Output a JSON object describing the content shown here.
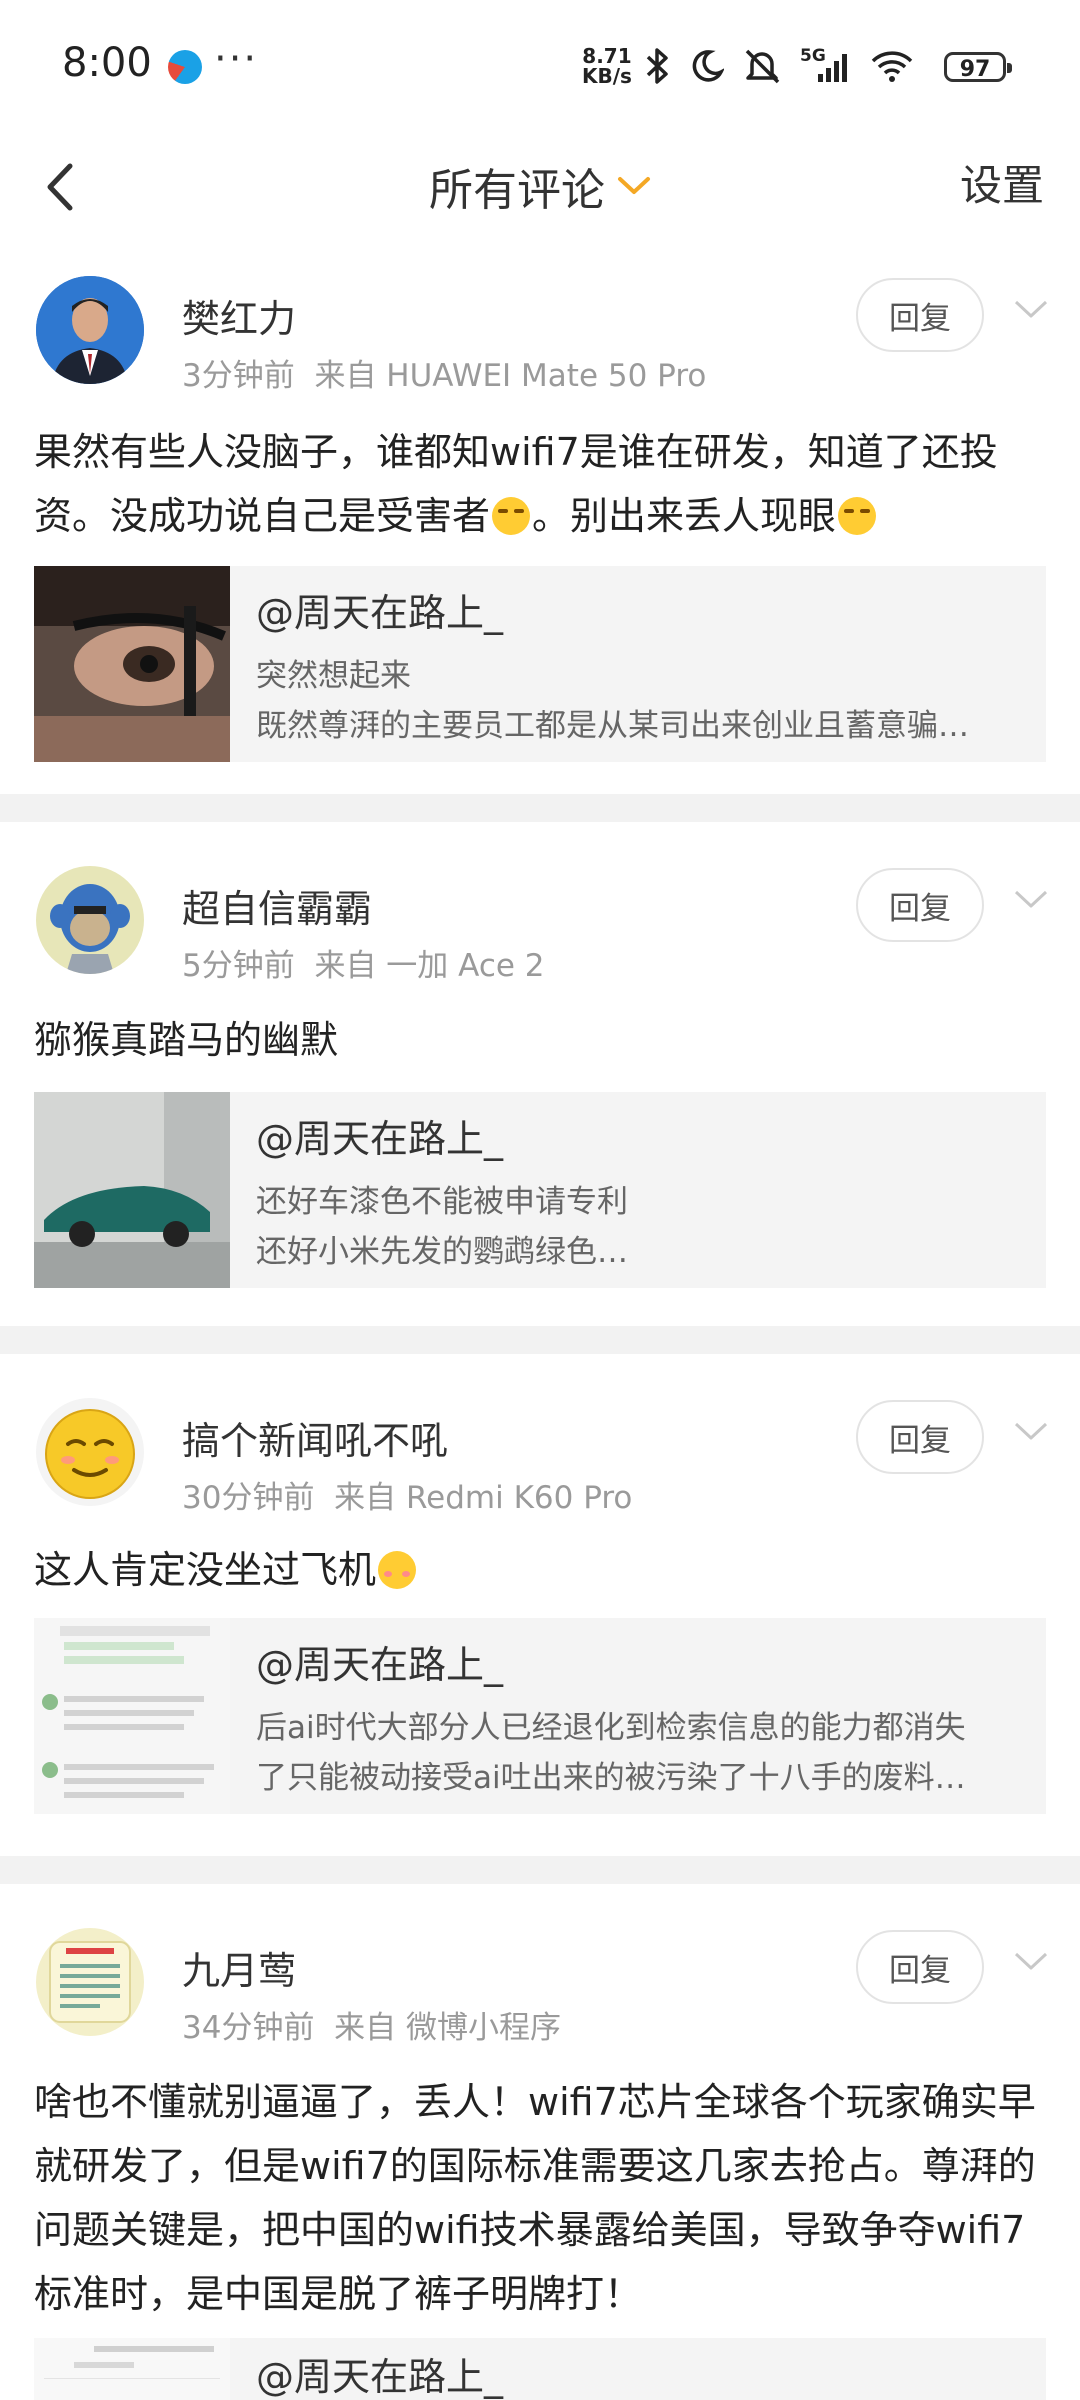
{
  "status_bar": {
    "time": "8:00",
    "dots": "···",
    "speed_value": "8.71",
    "speed_unit": "KB/s",
    "network": "5G",
    "battery": "97"
  },
  "header": {
    "title": "所有评论",
    "settings": "设置"
  },
  "comments": [
    {
      "name": "樊红力",
      "time": "3分钟前",
      "source": "来自 HUAWEI Mate 50 Pro",
      "text_parts": [
        "果然有些人没脑子，谁都知wifi7是谁在研发，知道了还投资。没成功说自己是受害者",
        "。别出来丢人现眼"
      ],
      "reply_label": "回复",
      "quote": {
        "author": "@周天在路上_",
        "line1": "突然想起来",
        "line2": "既然尊湃的主要员工都是从某司出来创业且蓄意骗…"
      }
    },
    {
      "name": "超自信霸霸",
      "time": "5分钟前",
      "source": "来自 一加 Ace 2",
      "text": "猕猴真踏马的幽默",
      "reply_label": "回复",
      "quote": {
        "author": "@周天在路上_",
        "line1": "还好车漆色不能被申请专利",
        "line2": "还好小米先发的鹦鹉绿色…"
      }
    },
    {
      "name": "搞个新闻吼不吼",
      "time": "30分钟前",
      "source": "来自 Redmi K60 Pro",
      "text": "这人肯定没坐过飞机",
      "reply_label": "回复",
      "quote": {
        "author": "@周天在路上_",
        "line1": "后ai时代大部分人已经退化到检索信息的能力都消失",
        "line2": "了只能被动接受ai吐出来的被污染了十八手的废料…"
      }
    },
    {
      "name": "九月莺",
      "time": "34分钟前",
      "source": "来自 微博小程序",
      "text": "啥也不懂就别逼逼了，丢人！wifi7芯片全球各个玩家确实早就研发了，但是wifi7的国际标准需要这几家去抢占。尊湃的问题关键是，把中国的wifi技术暴露给美国，导致争夺wifi7标准时，是中国是脱了裤子明牌打！",
      "reply_label": "回复",
      "quote": {
        "author": "@周天在路上_"
      }
    }
  ],
  "colors": {
    "accent": "#f4a825",
    "divider": "#f2f2f2",
    "meta": "#9a9a9a"
  }
}
